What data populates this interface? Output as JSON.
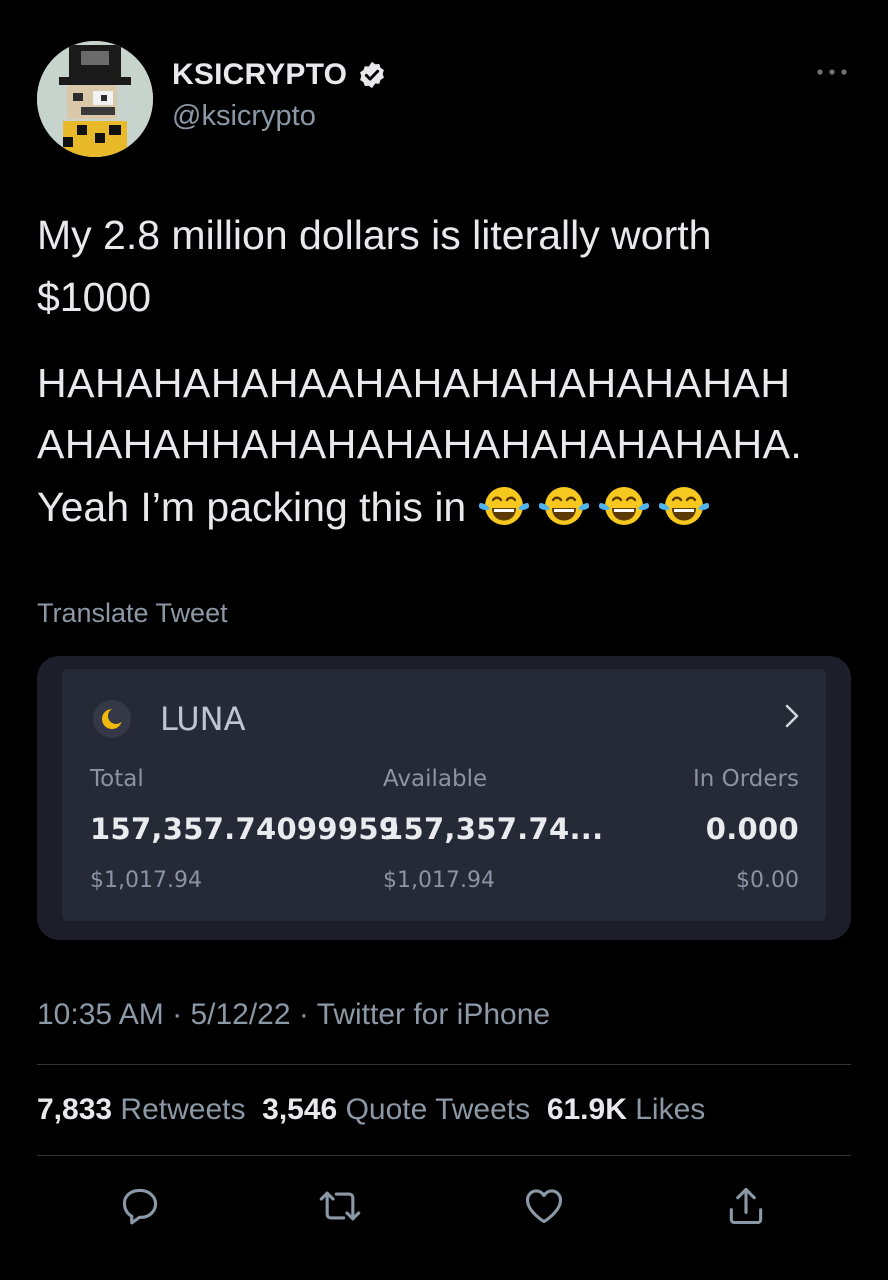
{
  "user": {
    "display_name": "KSICRYPTO",
    "handle": "@ksicrypto",
    "verified": true,
    "avatar": "pixel-art-ape-avatar"
  },
  "tweet": {
    "lines": [
      "My 2.8 million dollars is literally worth",
      "$1000",
      "HAHAHAHAHAAHAHAHAHAHAHAHAH",
      "AHAHAHHAHAHAHAHAHAHAHAHAHA.",
      "Yeah I’m packing this in"
    ],
    "emojis": [
      "laughing-tears-emoji",
      "laughing-tears-emoji",
      "laughing-tears-emoji",
      "laughing-tears-emoji"
    ],
    "translate_label": "Translate Tweet"
  },
  "card": {
    "coin": "LUNA",
    "columns": [
      {
        "header": "Total",
        "value": "157,357.74099959",
        "usd": "$1,017.94"
      },
      {
        "header": "Available",
        "value": "157,357.74...",
        "usd": "$1,017.94"
      },
      {
        "header": "In Orders",
        "value": "0.000",
        "usd": "$0.00"
      }
    ],
    "colors": {
      "card_bg": "#1c1f29",
      "panel_bg": "#262a37",
      "coin_icon": "#f0b90b"
    }
  },
  "meta": {
    "time": "10:35 AM",
    "date": "5/12/22",
    "source": "Twitter for iPhone",
    "separator": " · "
  },
  "stats": {
    "retweets_count": "7,833",
    "retweets_label": "Retweets",
    "quotes_count": "3,546",
    "quotes_label": "Quote Tweets",
    "likes_count": "61.9K",
    "likes_label": "Likes"
  },
  "actions": [
    "reply-icon",
    "retweet-icon",
    "like-icon",
    "share-icon"
  ],
  "colors": {
    "background": "#000000",
    "text": "#e7e9ea",
    "secondary": "#8b98a5",
    "divider": "#2f3336"
  }
}
